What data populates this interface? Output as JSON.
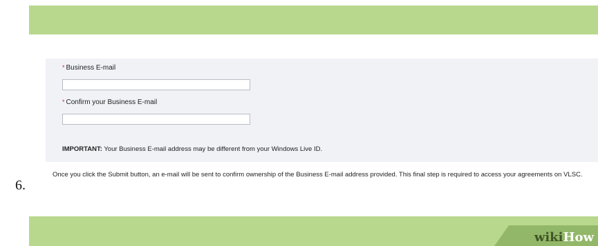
{
  "form": {
    "required_marker": "*",
    "business_email_label": "Business E-mail",
    "business_email_value": "",
    "confirm_email_label": "Confirm your Business E-mail",
    "confirm_email_value": "",
    "important_prefix": "IMPORTANT:",
    "important_text": "Your Business E-mail address may be different from your Windows Live ID."
  },
  "step": {
    "number": "6.",
    "text": "Once you click the Submit button, an e-mail will be sent to confirm ownership of the Business E-mail address provided. This final step is required to access your agreements on VLSC."
  },
  "watermark": {
    "part1": "wiki",
    "part2": "How"
  },
  "colors": {
    "band_green": "#b8d88e",
    "tab_green": "#93b768",
    "panel_bg": "#f0f2f6",
    "required_red": "#c0302a"
  }
}
